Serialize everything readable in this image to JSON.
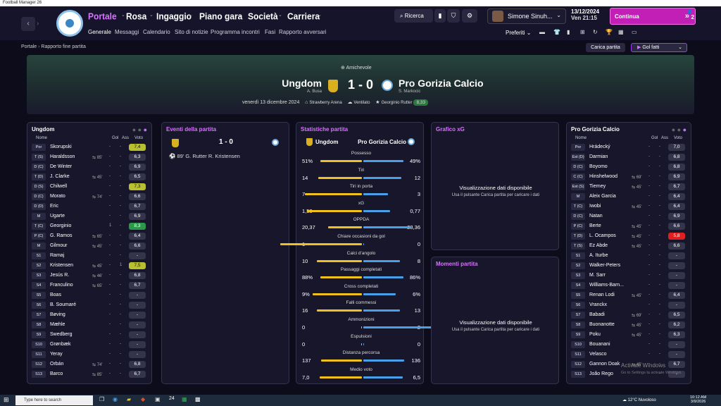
{
  "window_title": "Football Manager 26",
  "nav": {
    "back": "‹",
    "forward": "›",
    "menus": [
      "Portale",
      "Rosa",
      "Ingaggio",
      "Piano gara",
      "Società",
      "Carriera"
    ],
    "submenus": [
      "Generale",
      "Messaggi",
      "Calendario",
      "Sito di notizie",
      "Programma incontri",
      "Fasi",
      "Rapporto avversari"
    ],
    "search": "Ricerca",
    "manager": "Simone Sinuh...",
    "date": "13/12/2024",
    "day_time": "Ven  21:15",
    "continue": "Continua",
    "notif_badge": "2",
    "preferiti": "Preferiti"
  },
  "breadcrumb": {
    "home": "Portale",
    "current": "Rapporto fine partita"
  },
  "buttons": {
    "carica": "Carica partita",
    "golfatti": "Gol fatti"
  },
  "match": {
    "competition": "Amichevole",
    "home_team": "Ungdom",
    "home_manager": "A. Busa",
    "score": "1 - 0",
    "away_team": "Pro Gorizia Calcio",
    "away_manager": "S. Markocic",
    "date": "venerdì 13 dicembre 2024",
    "stadium": "Strawberry Arena",
    "weather": "Ventilato",
    "motm_name": "Georginio Rutter",
    "motm_rating": "8,33"
  },
  "home_lineup": {
    "title": "Ungdom",
    "headers": {
      "name": "Nome",
      "goals": "Gol",
      "assists": "Ass",
      "rating": "Voto"
    },
    "players": [
      {
        "pos": "Por",
        "name": "Skorupski",
        "ev": "",
        "g": "-",
        "a": "-",
        "r": "7,4"
      },
      {
        "pos": "T (S)",
        "name": "Haraldsson",
        "ev": "85'",
        "g": "-",
        "a": "-",
        "r": "6,3"
      },
      {
        "pos": "D (C)",
        "name": "De Winter",
        "ev": "",
        "g": "-",
        "a": "-",
        "r": "6,9"
      },
      {
        "pos": "T (D)",
        "name": "J. Clarke",
        "ev": "45'",
        "g": "-",
        "a": "-",
        "r": "6,5"
      },
      {
        "pos": "D (S)",
        "name": "Chilwell",
        "ev": "",
        "g": "-",
        "a": "-",
        "r": "7,3"
      },
      {
        "pos": "D (C)",
        "name": "Morato",
        "ev": "74'",
        "g": "-",
        "a": "-",
        "r": "6,6"
      },
      {
        "pos": "D (D)",
        "name": "Eric",
        "ev": "",
        "g": "-",
        "a": "-",
        "r": "6,7"
      },
      {
        "pos": "M",
        "name": "Ugarte",
        "ev": "",
        "g": "-",
        "a": "-",
        "r": "6,9"
      },
      {
        "pos": "T (C)",
        "name": "Georginio",
        "ev": "",
        "g": "1",
        "a": "-",
        "r": "8,3"
      },
      {
        "pos": "P (C)",
        "name": "G. Ramos",
        "ev": "65'",
        "g": "-",
        "a": "-",
        "r": "6,4"
      },
      {
        "pos": "M",
        "name": "Gilmour",
        "ev": "45'",
        "g": "-",
        "a": "-",
        "r": "6,6"
      },
      {
        "pos": "S1",
        "name": "Ramaj",
        "ev": "",
        "g": "-",
        "a": "-",
        "r": "-"
      },
      {
        "pos": "S2",
        "name": "Kristensen",
        "ev": "45'",
        "g": "-",
        "a": "1",
        "r": "7,5"
      },
      {
        "pos": "S3",
        "name": "Jesús R.",
        "ev": "46'",
        "g": "-",
        "a": "-",
        "r": "6,8"
      },
      {
        "pos": "S4",
        "name": "Franculino",
        "ev": "65'",
        "g": "-",
        "a": "-",
        "r": "6,7"
      },
      {
        "pos": "S5",
        "name": "Boas",
        "ev": "",
        "g": "-",
        "a": "-",
        "r": "-"
      },
      {
        "pos": "S6",
        "name": "B. Soumaré",
        "ev": "",
        "g": "-",
        "a": "-",
        "r": "-"
      },
      {
        "pos": "S7",
        "name": "Bøving",
        "ev": "",
        "g": "-",
        "a": "-",
        "r": "-"
      },
      {
        "pos": "S8",
        "name": "Mæhle",
        "ev": "",
        "g": "-",
        "a": "-",
        "r": "-"
      },
      {
        "pos": "S9",
        "name": "Swedberg",
        "ev": "",
        "g": "-",
        "a": "-",
        "r": "-"
      },
      {
        "pos": "S10",
        "name": "Grønbæk",
        "ev": "",
        "g": "-",
        "a": "-",
        "r": "-"
      },
      {
        "pos": "S11",
        "name": "Yeray",
        "ev": "",
        "g": "-",
        "a": "-",
        "r": "-"
      },
      {
        "pos": "S12",
        "name": "Orbán",
        "ev": "74'",
        "g": "-",
        "a": "-",
        "r": "6,8"
      },
      {
        "pos": "S13",
        "name": "Barco",
        "ev": "85'",
        "g": "-",
        "a": "-",
        "r": "6,7"
      }
    ]
  },
  "away_lineup": {
    "title": "Pro Gorizia Calcio",
    "headers": {
      "name": "Nome",
      "goals": "Gol",
      "assists": "Ass",
      "rating": "Voto"
    },
    "players": [
      {
        "pos": "Por",
        "name": "Hrádecký",
        "ev": "",
        "g": "-",
        "a": "-",
        "r": "7,0"
      },
      {
        "pos": "Est (D)",
        "name": "Darmian",
        "ev": "",
        "g": "-",
        "a": "-",
        "r": "6,8"
      },
      {
        "pos": "D (C)",
        "name": "Boyomo",
        "ev": "",
        "g": "-",
        "a": "-",
        "r": "6,8"
      },
      {
        "pos": "C (C)",
        "name": "Hinshelwood",
        "ev": "69'",
        "g": "-",
        "a": "-",
        "r": "6,9"
      },
      {
        "pos": "Est (S)",
        "name": "Tierney",
        "ev": "45'",
        "g": "-",
        "a": "-",
        "r": "6,7"
      },
      {
        "pos": "M",
        "name": "Aleix Garcia",
        "ev": "",
        "g": "-",
        "a": "-",
        "r": "6,4"
      },
      {
        "pos": "T (C)",
        "name": "Iwobi",
        "ev": "45'",
        "g": "-",
        "a": "-",
        "r": "6,4"
      },
      {
        "pos": "D (C)",
        "name": "Natan",
        "ev": "",
        "g": "-",
        "a": "-",
        "r": "6,9"
      },
      {
        "pos": "P (C)",
        "name": "Berte",
        "ev": "45'",
        "g": "-",
        "a": "-",
        "r": "6,6"
      },
      {
        "pos": "T (D)",
        "name": "L. Ocampos",
        "ev": "45'",
        "g": "-",
        "a": "-",
        "r": "5,8"
      },
      {
        "pos": "T (S)",
        "name": "Ez Abde",
        "ev": "45'",
        "g": "-",
        "a": "-",
        "r": "6,6"
      },
      {
        "pos": "S1",
        "name": "A. Iturbe",
        "ev": "",
        "g": "-",
        "a": "-",
        "r": "-"
      },
      {
        "pos": "S2",
        "name": "Walker-Peters",
        "ev": "",
        "g": "-",
        "a": "-",
        "r": "-"
      },
      {
        "pos": "S3",
        "name": "M. Sarr",
        "ev": "",
        "g": "-",
        "a": "-",
        "r": "-"
      },
      {
        "pos": "S4",
        "name": "Williams-Barn...",
        "ev": "",
        "g": "-",
        "a": "-",
        "r": "-"
      },
      {
        "pos": "S5",
        "name": "Renan Lodi",
        "ev": "45'",
        "g": "-",
        "a": "-",
        "r": "6,4"
      },
      {
        "pos": "S6",
        "name": "Vranckx",
        "ev": "",
        "g": "-",
        "a": "-",
        "r": "-"
      },
      {
        "pos": "S7",
        "name": "Babadi",
        "ev": "69'",
        "g": "-",
        "a": "-",
        "r": "6,5"
      },
      {
        "pos": "S8",
        "name": "Buonanotte",
        "ev": "45'",
        "g": "-",
        "a": "-",
        "r": "6,2"
      },
      {
        "pos": "S9",
        "name": "Poku",
        "ev": "45'",
        "g": "-",
        "a": "-",
        "r": "6,3"
      },
      {
        "pos": "S10",
        "name": "Bouanani",
        "ev": "",
        "g": "-",
        "a": "-",
        "r": "-"
      },
      {
        "pos": "S11",
        "name": "Velasco",
        "ev": "",
        "g": "-",
        "a": "-",
        "r": "-"
      },
      {
        "pos": "S12",
        "name": "Gannon Doak",
        "ev": "45'",
        "g": "-",
        "a": "-",
        "r": "6,7"
      },
      {
        "pos": "S13",
        "name": "João Rego",
        "ev": "",
        "g": "-",
        "a": "-",
        "r": "-"
      }
    ]
  },
  "events": {
    "title": "Eventi della partita",
    "score": "1 - 0",
    "items": [
      {
        "minute": "89'",
        "text": "G. Rutter  R. Kristensen"
      }
    ]
  },
  "stats": {
    "title": "Statistiche partita",
    "home": "Ungdom",
    "away": "Pro Gorizia Calcio",
    "rows": [
      {
        "label": "Possesso",
        "h": "51%",
        "a": "49%",
        "hv": 51,
        "av": 49
      },
      {
        "label": "Tiri",
        "h": "14",
        "a": "12",
        "hv": 14,
        "av": 12
      },
      {
        "label": "Tiri in porta",
        "h": "7",
        "a": "3",
        "hv": 7,
        "av": 3
      },
      {
        "label": "xG",
        "h": "1,58",
        "a": "0,77",
        "hv": 1.58,
        "av": 0.77
      },
      {
        "label": "OPPDA",
        "h": "20,37",
        "a": "28,36",
        "hv": 20.37,
        "av": 28.36
      },
      {
        "label": "Chiare occasioni da gol",
        "h": "1",
        "a": "0",
        "hv": 1,
        "av": 0
      },
      {
        "label": "Calci d'angolo",
        "h": "10",
        "a": "8",
        "hv": 10,
        "av": 8
      },
      {
        "label": "Passaggi completati",
        "h": "88%",
        "a": "86%",
        "hv": 88,
        "av": 86
      },
      {
        "label": "Cross completati",
        "h": "9%",
        "a": "6%",
        "hv": 9,
        "av": 6
      },
      {
        "label": "Falli commessi",
        "h": "16",
        "a": "13",
        "hv": 16,
        "av": 13
      },
      {
        "label": "Ammonizioni",
        "h": "0",
        "a": "2",
        "hv": 0,
        "av": 2
      },
      {
        "label": "Espulsioni",
        "h": "0",
        "a": "0",
        "hv": 0,
        "av": 0
      },
      {
        "label": "Distanza percorsa",
        "h": "137",
        "a": "136",
        "hv": 137,
        "av": 136
      },
      {
        "label": "Medio voto",
        "h": "7,0",
        "a": "6,5",
        "hv": 7.0,
        "av": 6.5
      }
    ]
  },
  "xg_panel": {
    "title": "Grafico xG",
    "empty": "Visualizzazione dati disponibile",
    "hint": "Usa il pulsante Carica partita per caricare i dati"
  },
  "moments_panel": {
    "title": "Momenti partita",
    "empty": "Visualizzazione dati disponibile",
    "hint": "Usa il pulsante Carica partita per caricare i dati"
  },
  "watermark": {
    "title": "Activate Windows",
    "sub": "Go to Settings to activate Windows."
  },
  "taskbar": {
    "search": "Type here to search",
    "weather": "12°C  Nuvoloso",
    "time": "10:12 AM",
    "date": "3/9/2026",
    "lang": "ENG\nIT"
  },
  "colors": {
    "accent": "#d873ff",
    "home_bar": "#f0c020",
    "away_bar": "#4aa0e8",
    "continue_btn": "#c21fb6"
  }
}
